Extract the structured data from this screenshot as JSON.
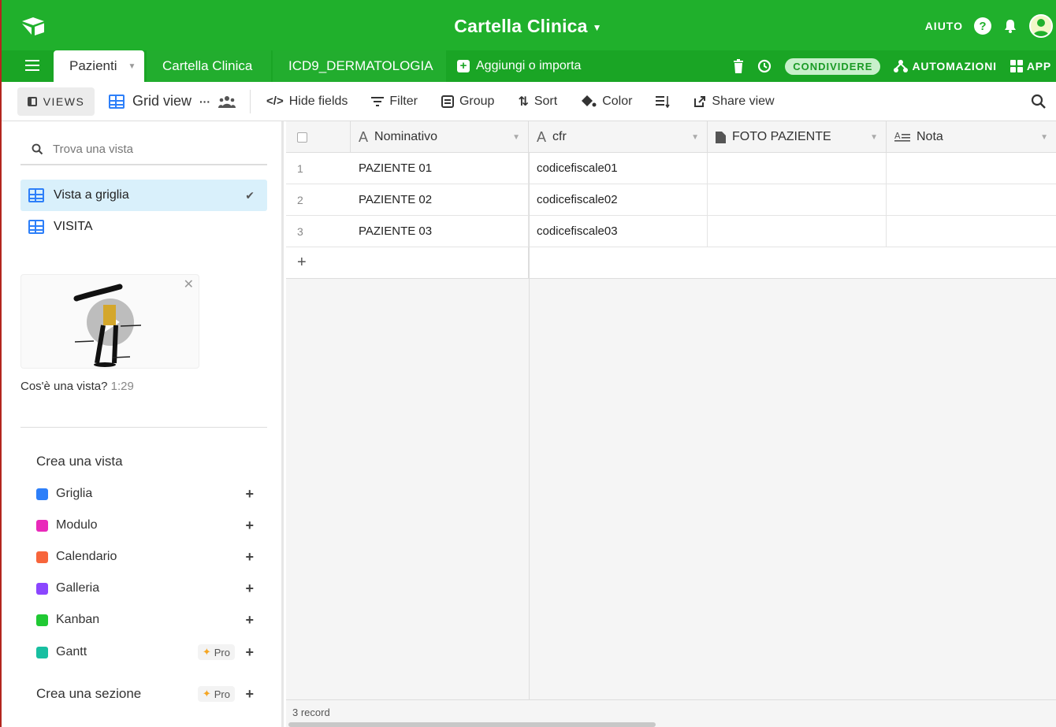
{
  "app": {
    "base_title": "Cartella Clinica",
    "help_label": "AIUTO",
    "help_icon_glyph": "?"
  },
  "tabs": [
    {
      "label": "Pazienti",
      "active": true
    },
    {
      "label": "Cartella Clinica",
      "active": false
    },
    {
      "label": "ICD9_DERMATOLOGIA",
      "active": false
    }
  ],
  "tabs_bar": {
    "add_import_label": "Aggiungi o importa",
    "share_label": "CONDIVIDERE",
    "automations_label": "AUTOMAZIONI",
    "apps_label": "APP"
  },
  "toolbar": {
    "views_label": "VIEWS",
    "current_view": "Grid view",
    "more_glyph": "···",
    "hide_fields": "Hide fields",
    "filter": "Filter",
    "group": "Group",
    "sort": "Sort",
    "color": "Color",
    "share_view": "Share view"
  },
  "sidebar": {
    "search_placeholder": "Trova una vista",
    "views": [
      {
        "label": "Vista a griglia",
        "active": true
      },
      {
        "label": "VISITA",
        "active": false
      }
    ],
    "video_caption": "Cos'è una vista?",
    "video_duration": "1:29",
    "create_title": "Crea una vista",
    "create_items": [
      {
        "label": "Griglia",
        "color": "#2d7ff9",
        "pro": false
      },
      {
        "label": "Modulo",
        "color": "#e929ba",
        "pro": false
      },
      {
        "label": "Calendario",
        "color": "#f7653b",
        "pro": false
      },
      {
        "label": "Galleria",
        "color": "#8b46ff",
        "pro": false
      },
      {
        "label": "Kanban",
        "color": "#20c933",
        "pro": false
      },
      {
        "label": "Gantt",
        "color": "#18bfa1",
        "pro": true
      }
    ],
    "pro_label": "Pro",
    "create_section": "Crea una sezione"
  },
  "grid": {
    "columns": [
      {
        "label": "Nominativo",
        "icon": "text-icon"
      },
      {
        "label": "cfr",
        "icon": "text-icon"
      },
      {
        "label": "FOTO PAZIENTE",
        "icon": "attachment-icon"
      },
      {
        "label": "Nota",
        "icon": "long-text-icon"
      }
    ],
    "rows": [
      {
        "num": "1",
        "nominativo": "PAZIENTE 01",
        "cfr": "codicefiscale01"
      },
      {
        "num": "2",
        "nominativo": "PAZIENTE 02",
        "cfr": "codicefiscale02"
      },
      {
        "num": "3",
        "nominativo": "PAZIENTE 03",
        "cfr": "codicefiscale03"
      }
    ],
    "record_count": "3 record"
  },
  "colors": {
    "brand_green": "#20b02c",
    "tab_green": "#1aa525",
    "accent_blue": "#2d7ff9"
  }
}
